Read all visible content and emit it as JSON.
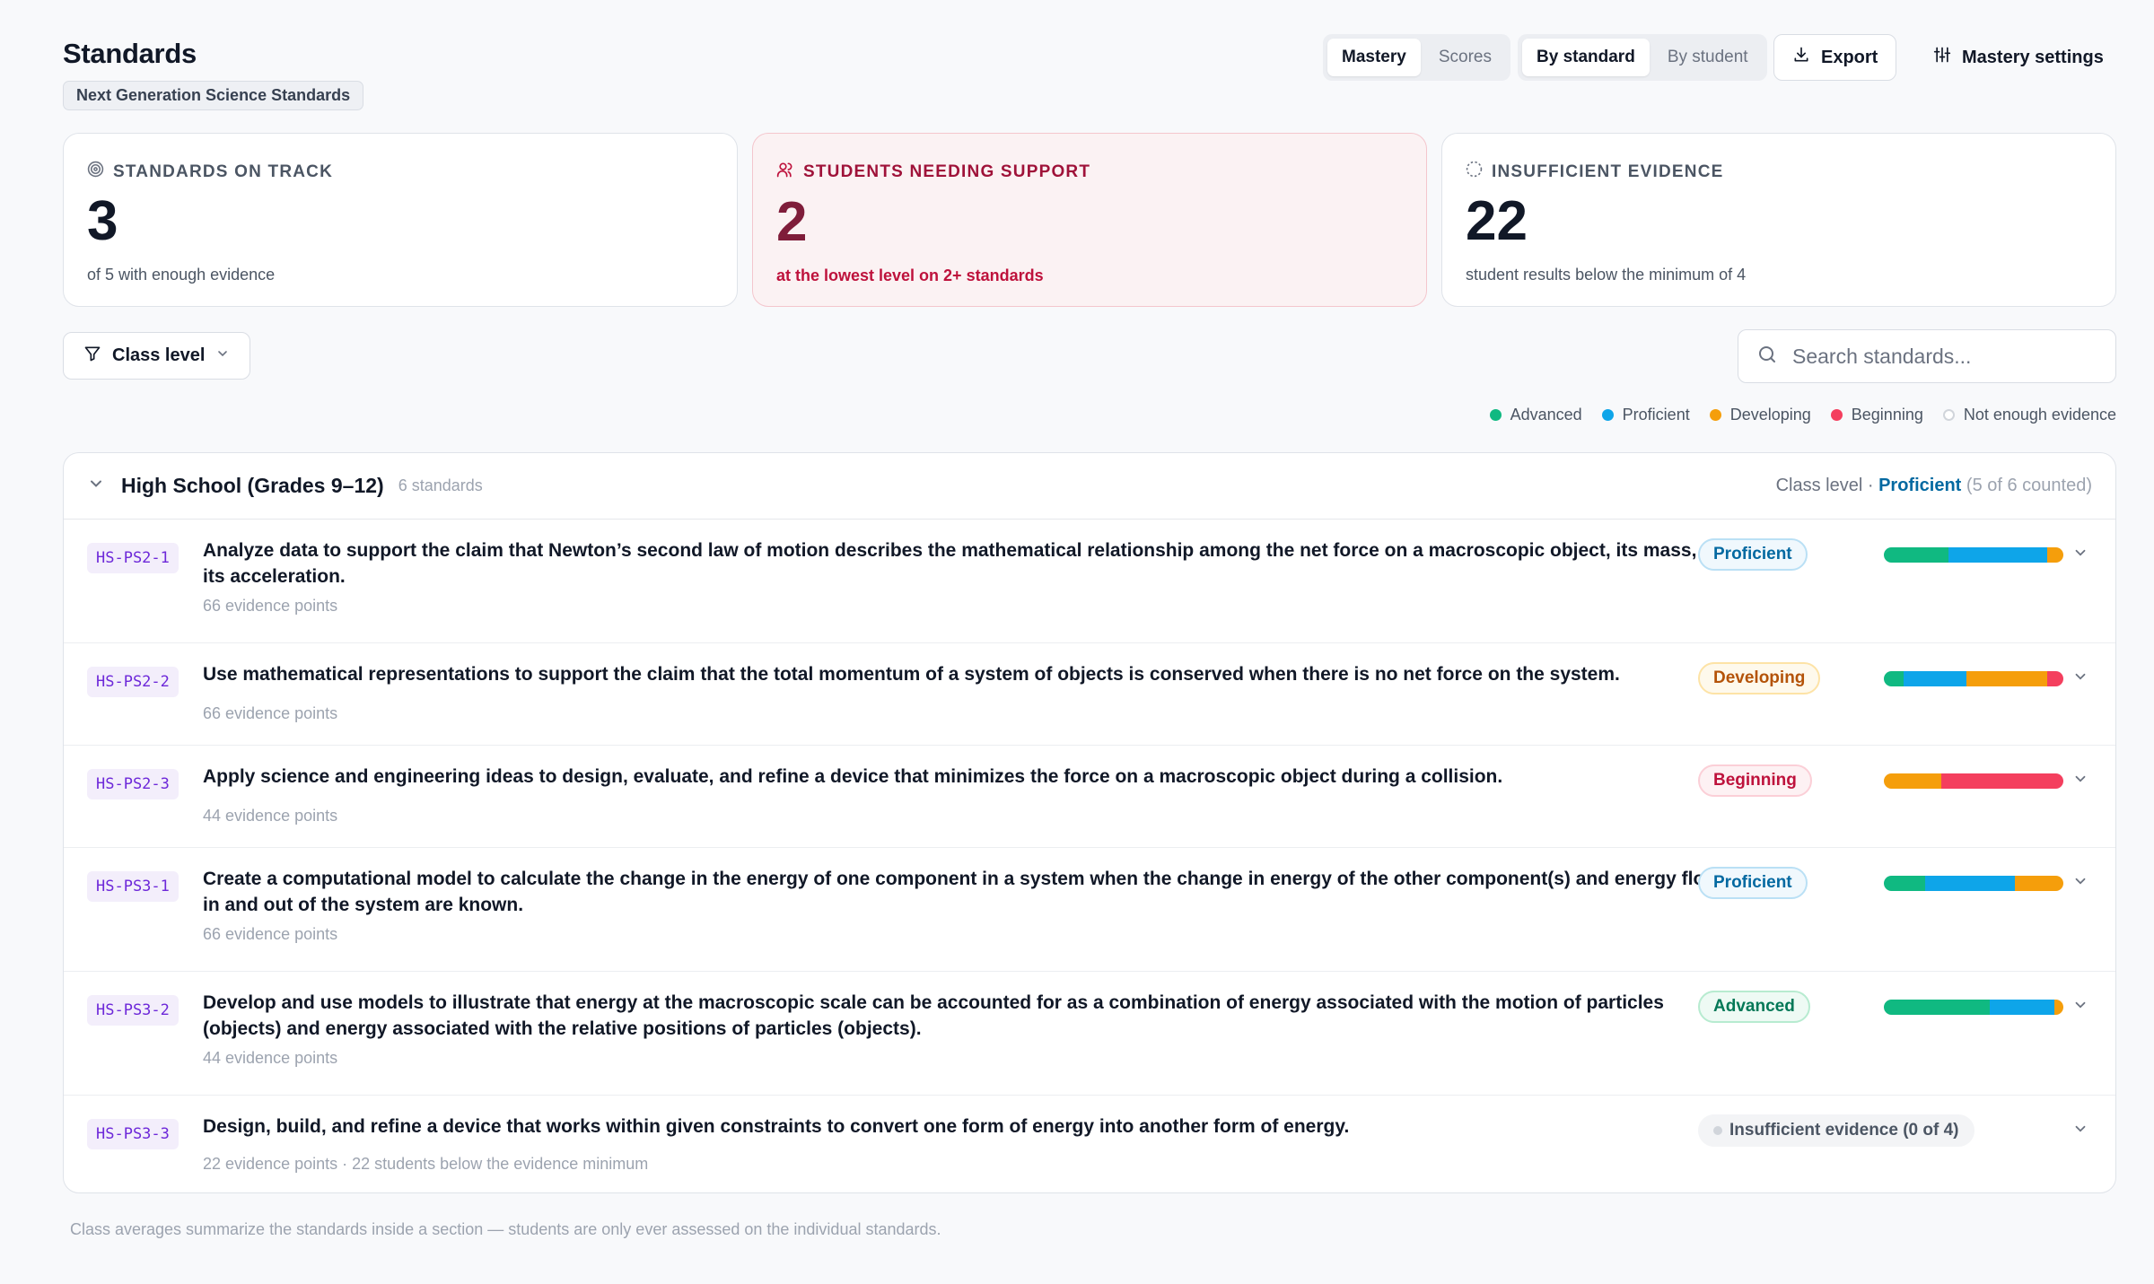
{
  "header": {
    "title": "Standards",
    "framework": "Next Generation Science Standards",
    "mode_options": [
      "Mastery",
      "Scores"
    ],
    "view_options": [
      "By standard",
      "By student"
    ],
    "export_label": "Export",
    "settings_label": "Mastery settings"
  },
  "stats": [
    {
      "label": "STANDARDS ON TRACK",
      "value": "3",
      "sub": "of 5 with enough evidence",
      "icon": "target-icon"
    },
    {
      "label": "STUDENTS NEEDING SUPPORT",
      "value": "2",
      "sub": "at the lowest level on 2+ standards",
      "icon": "users-icon"
    },
    {
      "label": "INSUFFICIENT EVIDENCE",
      "value": "22",
      "sub": "student results below the minimum of 4",
      "icon": "dashed-circle-icon"
    }
  ],
  "filter": {
    "label": "Class level"
  },
  "search": {
    "placeholder": "Search standards..."
  },
  "legend": [
    {
      "label": "Advanced",
      "color": "#10b981"
    },
    {
      "label": "Proficient",
      "color": "#0ea5e9"
    },
    {
      "label": "Developing",
      "color": "#f59e0b"
    },
    {
      "label": "Beginning",
      "color": "#f43f5e"
    },
    {
      "label": "Not enough evidence",
      "color": "#d1d5db"
    }
  ],
  "section": {
    "title": "High School (Grades 9–12)",
    "count": "6 standards",
    "class_level_label": "Class level ·",
    "class_level_value": "Proficient",
    "class_level_counted": "(5 of 6 counted)"
  },
  "standards": [
    {
      "code": "HS-PS2-1",
      "description": "Analyze data to support the claim that Newton’s second law of motion describes the mathematical relationship among the net force on a macroscopic object, its mass, and its acceleration.",
      "meta": "66 evidence points",
      "level": "Proficient",
      "level_class": "proficient",
      "distribution": {
        "advanced": 0.36,
        "proficient": 0.55,
        "developing": 0.09,
        "beginning": 0
      }
    },
    {
      "code": "HS-PS2-2",
      "description": "Use mathematical representations to support the claim that the total momentum of a system of objects is conserved when there is no net force on the system.",
      "meta": "66 evidence points",
      "level": "Developing",
      "level_class": "developing",
      "distribution": {
        "advanced": 0.11,
        "proficient": 0.35,
        "developing": 0.45,
        "beginning": 0.09
      }
    },
    {
      "code": "HS-PS2-3",
      "description": "Apply science and engineering ideas to design, evaluate, and refine a device that minimizes the force on a macroscopic object during a collision.",
      "meta": "44 evidence points",
      "level": "Beginning",
      "level_class": "beginning",
      "distribution": {
        "advanced": 0,
        "proficient": 0,
        "developing": 0.32,
        "beginning": 0.68
      }
    },
    {
      "code": "HS-PS3-1",
      "description": "Create a computational model to calculate the change in the energy of one component in a system when the change in energy of the other component(s) and energy flows in and out of the system are known.",
      "meta": "66 evidence points",
      "level": "Proficient",
      "level_class": "proficient",
      "distribution": {
        "advanced": 0.23,
        "proficient": 0.5,
        "developing": 0.27,
        "beginning": 0
      }
    },
    {
      "code": "HS-PS3-2",
      "description": "Develop and use models to illustrate that energy at the macroscopic scale can be accounted for as a combination of energy associated with the motion of particles (objects) and energy associated with the relative positions of particles (objects).",
      "meta": "44 evidence points",
      "level": "Advanced",
      "level_class": "advanced",
      "distribution": {
        "advanced": 0.59,
        "proficient": 0.36,
        "developing": 0.05,
        "beginning": 0
      }
    },
    {
      "code": "HS-PS3-3",
      "description": "Design, build, and refine a device that works within given constraints to convert one form of energy into another form of energy.",
      "meta": "22 evidence points · 22 students below the evidence minimum",
      "level": "Insufficient evidence (0 of 4)",
      "level_class": "insufficient",
      "distribution": null
    }
  ],
  "footnote": "Class averages summarize the standards inside a section — students are only ever assessed on the individual standards."
}
